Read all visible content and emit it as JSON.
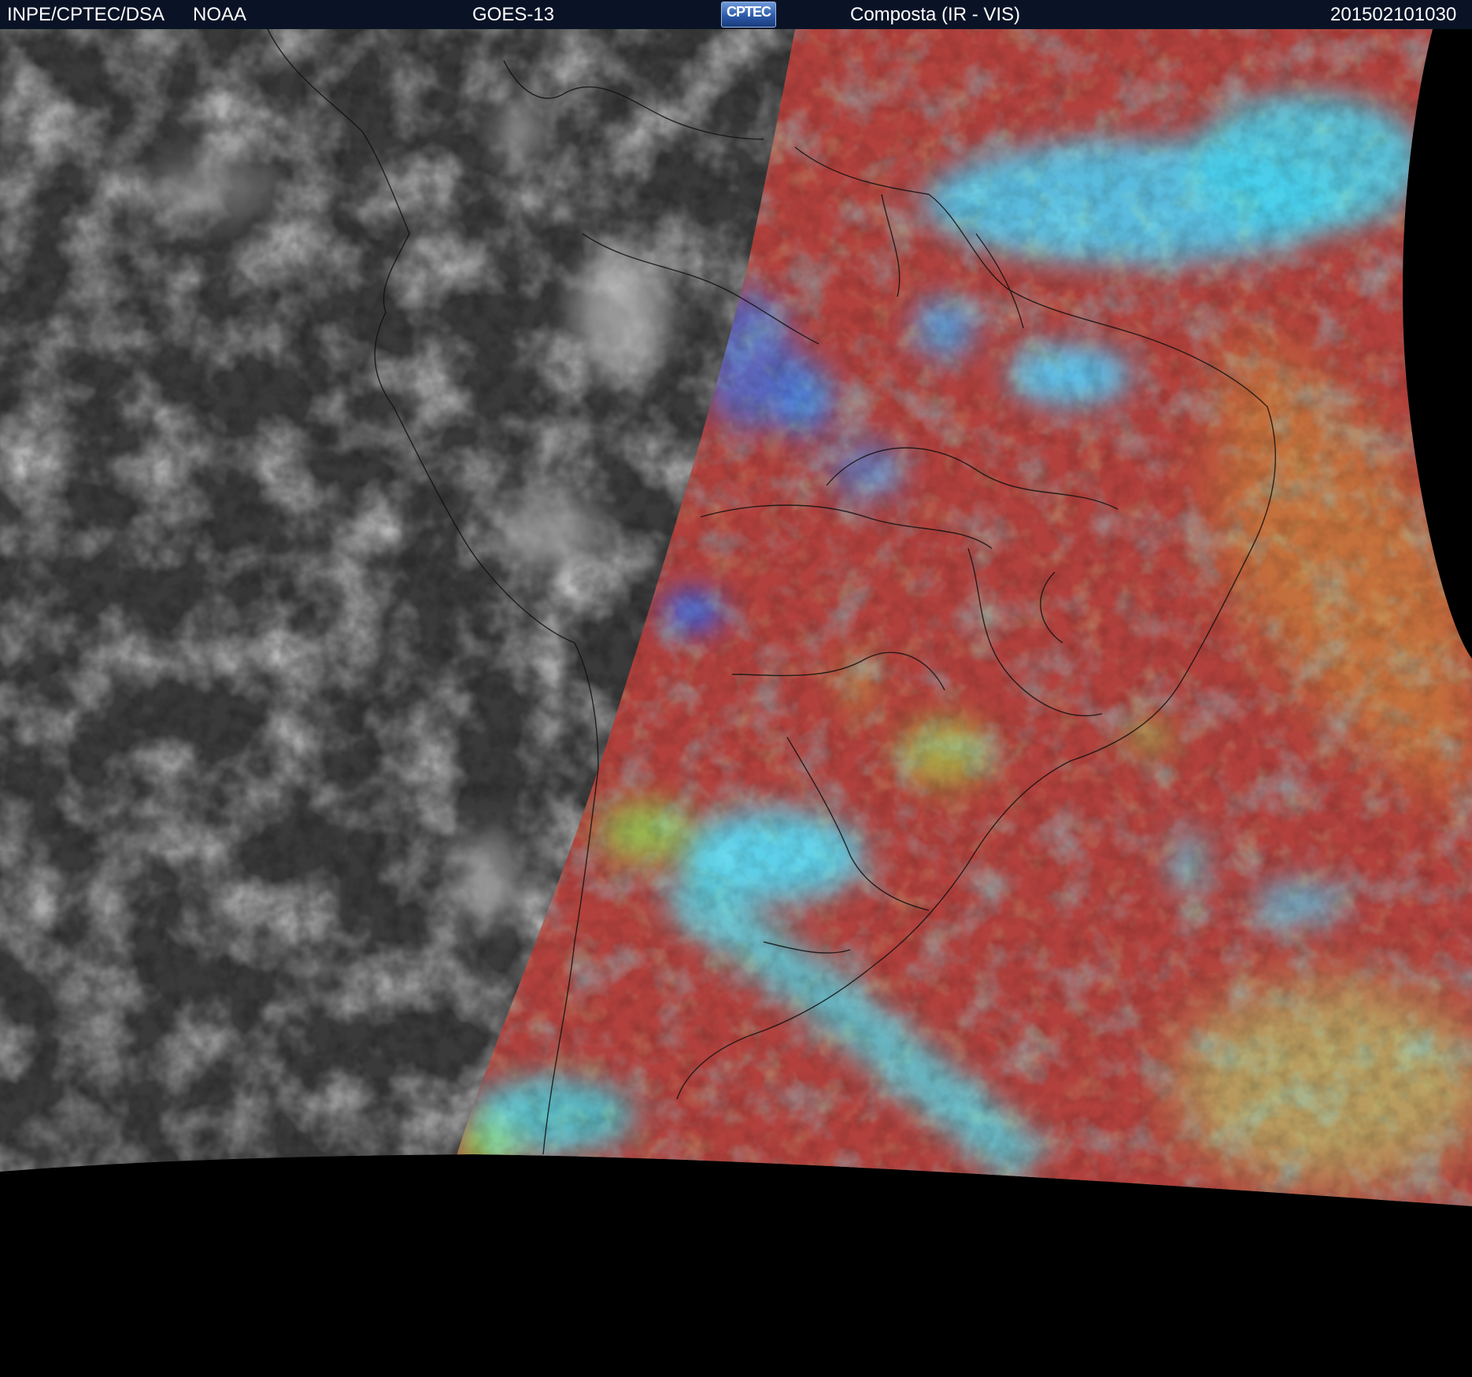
{
  "header": {
    "left_agency": "INPE/CPTEC/DSA",
    "left_partner": "NOAA",
    "satellite": "GOES-13",
    "logo_text": "CPTEC",
    "product": "Composta (IR - VIS)",
    "timestamp": "201502101030"
  },
  "imagery": {
    "ir_region": "grayscale infrared (night side)",
    "vis_region": "false-color composite (day side)",
    "colors": {
      "header_background": "#0a1326",
      "ir_base": "#3c3c3c",
      "land_red": "#b8443e",
      "cloud_cyan": "#3ad4ee",
      "cloud_blue": "#3f66e0",
      "cloud_green": "#8fe25a",
      "ocean_orange": "#cf7a3a",
      "space": "#000000"
    }
  }
}
